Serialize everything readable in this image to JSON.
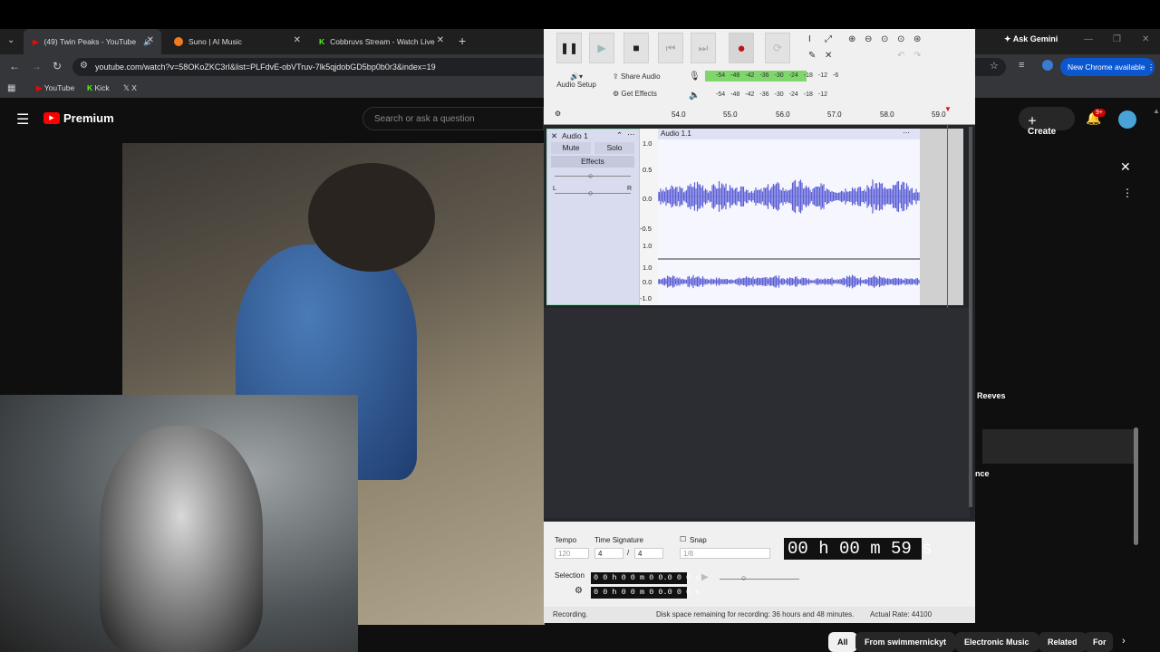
{
  "browser": {
    "tabs": [
      {
        "label": "(49) Twin Peaks - YouTube",
        "color": "#ff0000"
      },
      {
        "label": "Suno | AI Music",
        "color": "#f47a20"
      },
      {
        "label": "Cobbruvs Stream - Watch Live",
        "color": "#53fc18"
      }
    ],
    "url": "youtube.com/watch?v=58OKoZKC3rI&list=PLFdvE-obVTruv-7lk5qjdobGD5bp0b0r3&index=19",
    "bookmarks": [
      "YouTube",
      "Kick",
      "X"
    ],
    "ask_gemini": "Ask Gemini",
    "new_chrome": "New Chrome available"
  },
  "youtube": {
    "logo": "Premium",
    "search_placeholder": "Search or ask a question",
    "create_label": "Create",
    "notif_badge": "9+",
    "side_texts": [
      "Reeves",
      "nce"
    ],
    "chips": [
      "All",
      "From swimmernickyt",
      "Electronic Music",
      "Related",
      "For"
    ]
  },
  "audacity": {
    "share_audio": "Share Audio",
    "get_effects": "Get Effects",
    "audio_setup": "Audio Setup",
    "meter_ticks": [
      "-54",
      "-48",
      "-42",
      "-36",
      "-30",
      "-24",
      "-18",
      "-12",
      "-6"
    ],
    "ruler_ticks": [
      "54.0",
      "55.0",
      "56.0",
      "57.0",
      "58.0",
      "59.0"
    ],
    "track": {
      "name": "Audio 1",
      "clip": "Audio 1.1",
      "mute": "Mute",
      "solo": "Solo",
      "effects": "Effects",
      "pan_l": "L",
      "pan_r": "R",
      "scale": [
        "1.0",
        "0.5",
        "0.0",
        "-0.5",
        "-1.0"
      ]
    },
    "tempo_label": "Tempo",
    "tempo_value": "120",
    "timesig_label": "Time Signature",
    "timesig_num": "4",
    "timesig_den": "4",
    "snap_label": "Snap",
    "snap_value": "1/8",
    "time_display": "00 h 00 m 59 s",
    "selection_label": "Selection",
    "selection_start": "0 0 h 0 0 m 0 0.0 0 0 s",
    "selection_end": "0 0 h 0 0 m 0 0.0 0 0 s",
    "status_left": "Recording.",
    "status_mid": "Disk space remaining for recording: 36 hours and 48 minutes.",
    "status_right": "Actual Rate: 44100"
  }
}
